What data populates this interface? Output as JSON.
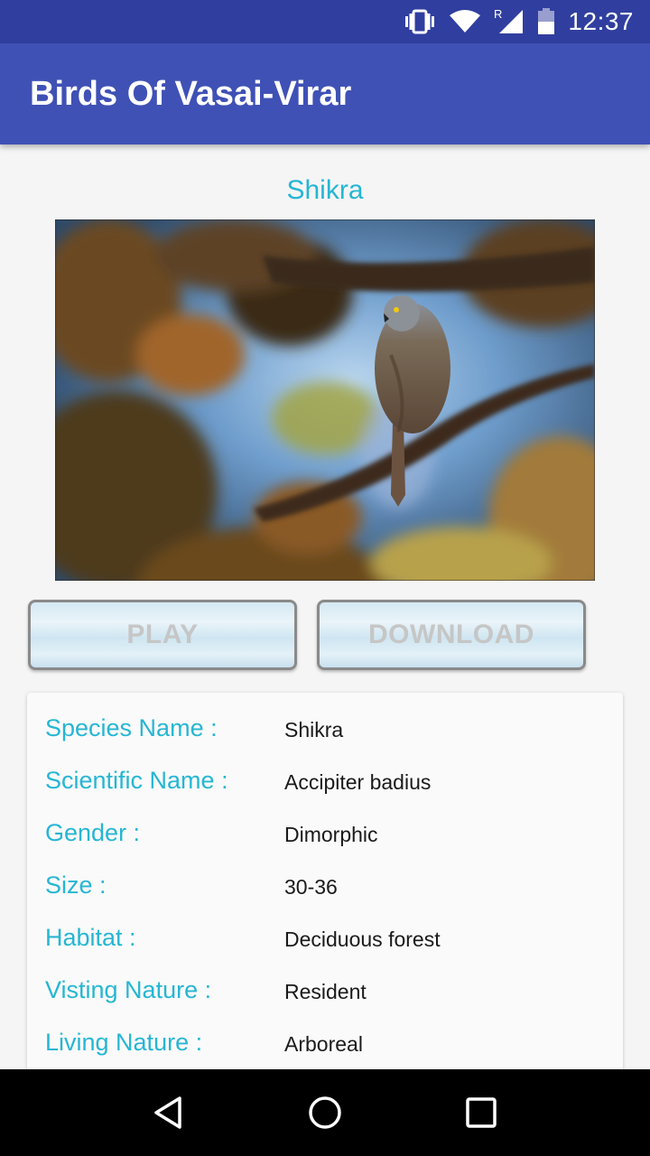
{
  "status_bar": {
    "time": "12:37",
    "roaming_indicator": "R",
    "icons": [
      "vibrate-icon",
      "wifi-icon",
      "cell-signal-icon",
      "battery-icon"
    ]
  },
  "app_bar": {
    "title": "Birds Of Vasai-Virar",
    "color": "#3f51b5"
  },
  "bird": {
    "name": "Shikra",
    "photo_alt": "Shikra"
  },
  "buttons": {
    "play_label": "PLAY",
    "download_label": "DOWNLOAD"
  },
  "details": [
    {
      "label": "Species Name :",
      "value": "Shikra"
    },
    {
      "label": "Scientific Name :",
      "value": "Accipiter badius"
    },
    {
      "label": "Gender :",
      "value": "Dimorphic"
    },
    {
      "label": "Size :",
      "value": "30-36"
    },
    {
      "label": "Habitat :",
      "value": "Deciduous forest"
    },
    {
      "label": "Visting Nature :",
      "value": "Resident"
    },
    {
      "label": "Living Nature :",
      "value": "Arboreal"
    }
  ],
  "colors": {
    "accent": "#26b6d3",
    "status_bar": "#303f9f"
  },
  "nav_bar": {
    "icons": [
      "back-icon",
      "home-icon",
      "recents-icon"
    ]
  }
}
